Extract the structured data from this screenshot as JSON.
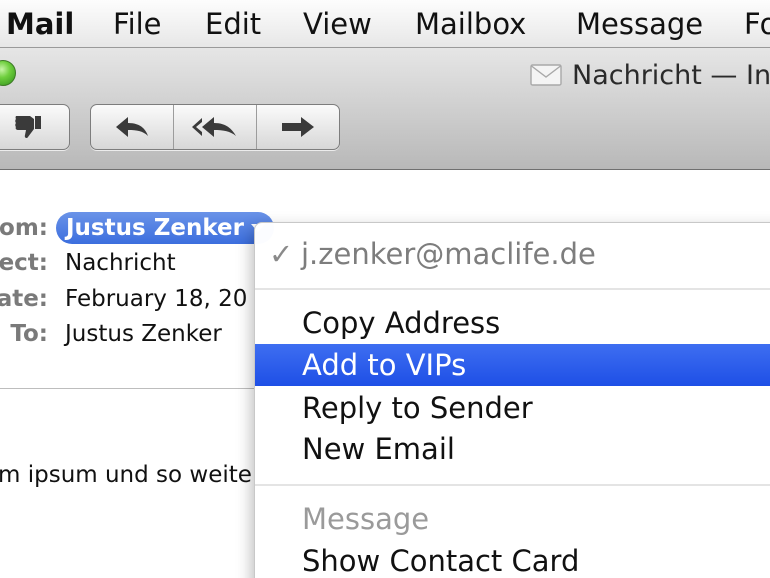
{
  "menubar": {
    "app_name": "Mail",
    "items": [
      "File",
      "Edit",
      "View",
      "Mailbox",
      "Message",
      "Fo"
    ]
  },
  "window": {
    "title": "Nachricht — In"
  },
  "toolbar": {
    "junk_icon": "thumbs-down-icon",
    "reply_icon": "reply-arrow-icon",
    "reply_all_icon": "reply-all-arrow-icon",
    "forward_icon": "forward-arrow-icon"
  },
  "header": {
    "from_label": "om:",
    "from_name": "Justus Zenker",
    "subject_label": "ect:",
    "subject_value": "Nachricht",
    "date_label": "ate:",
    "date_value": "February 18, 20",
    "to_label": "To:",
    "to_value": "Justus Zenker"
  },
  "body": {
    "text": "m ipsum und so weite"
  },
  "context_menu": {
    "checkmark": "✓",
    "email": "j.zenker@maclife.de",
    "copy_address": "Copy Address",
    "add_to_vips": "Add to VIPs",
    "reply_to_sender": "Reply to Sender",
    "new_email": "New Email",
    "message_header": "Message",
    "show_contact_card": "Show Contact Card"
  },
  "colors": {
    "highlight": "#2d5cec",
    "chip": "#4a7be0",
    "zoom_button": "#5cc236"
  }
}
